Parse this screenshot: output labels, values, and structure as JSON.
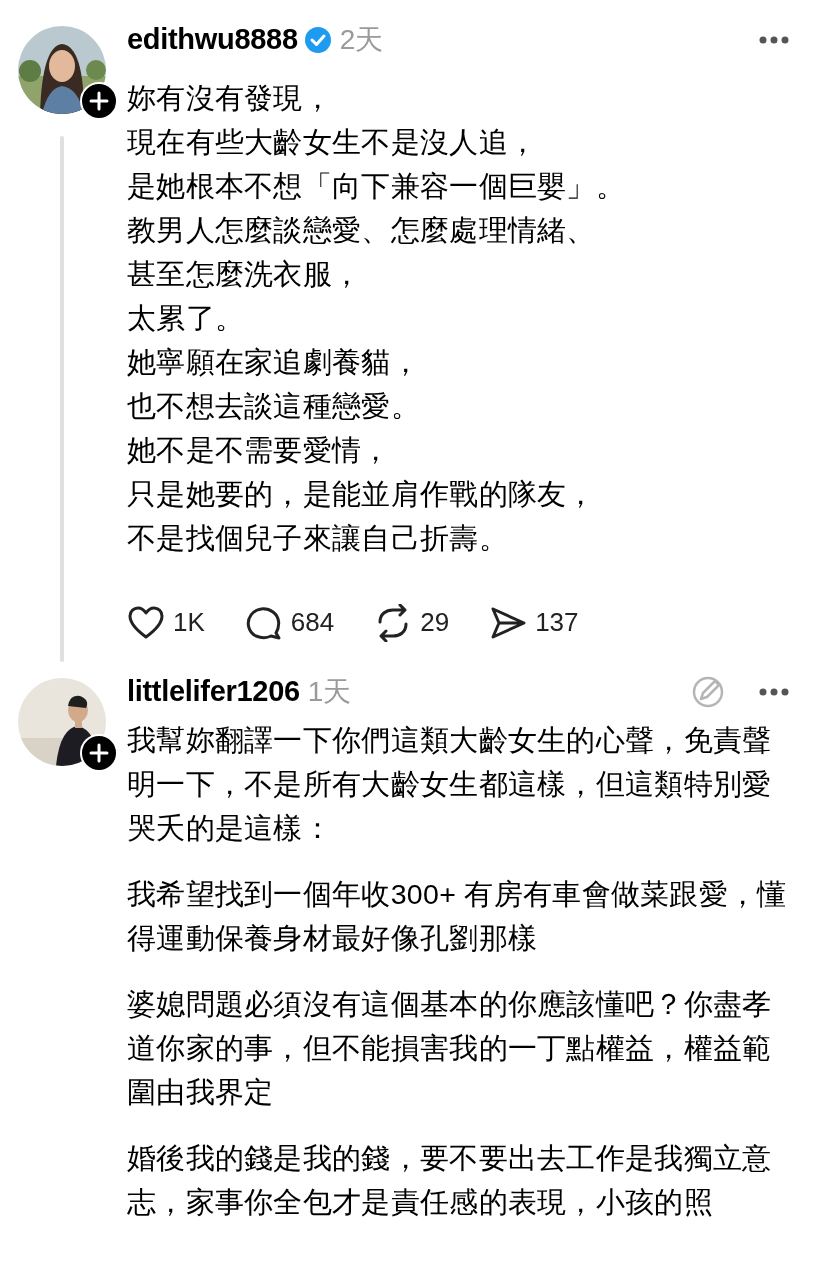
{
  "posts": [
    {
      "username": "edithwu8888",
      "verified": true,
      "time": "2天",
      "edit_icon": false,
      "thread_line": true,
      "lines": [
        "妳有沒有發現，",
        "現在有些大齡女生不是沒人追，",
        "是她根本不想「向下兼容一個巨嬰」。",
        "教男人怎麼談戀愛、怎麼處理情緒、",
        "甚至怎麼洗衣服，",
        "太累了。",
        "她寧願在家追劇養貓，",
        "也不想去談這種戀愛。",
        "她不是不需要愛情，",
        "只是她要的，是能並肩作戰的隊友，",
        "不是找個兒子來讓自己折壽。"
      ],
      "stats": [
        {
          "kind": "like",
          "count": "1K"
        },
        {
          "kind": "reply",
          "count": "684"
        },
        {
          "kind": "repost",
          "count": "29"
        },
        {
          "kind": "share",
          "count": "137"
        }
      ]
    },
    {
      "username": "littlelifer1206",
      "verified": false,
      "time": "1天",
      "edit_icon": true,
      "thread_line": false,
      "paragraphs": [
        "我幫妳翻譯一下你們這類大齡女生的心聲，免責聲明一下，不是所有大齡女生都這樣，但這類特別愛哭夭的是這樣：",
        "我希望找到一個年收300+ 有房有車會做菜跟愛，懂得運動保養身材最好像孔劉那樣",
        "婆媳問題必須沒有這個基本的你應該懂吧？你盡孝道你家的事，但不能損害我的一丁點權益，權益範圍由我界定",
        "婚後我的錢是我的錢，要不要出去工作是我獨立意志，家事你全包才是責任感的表現，小孩的照"
      ]
    }
  ]
}
